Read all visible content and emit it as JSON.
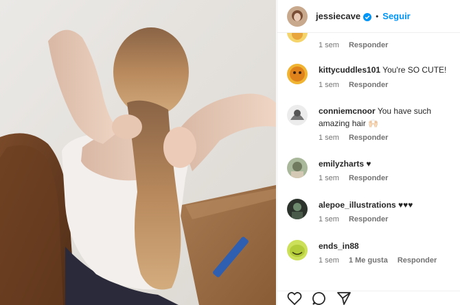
{
  "header": {
    "username": "jessiecave",
    "separator": "•",
    "follow_label": "Seguir",
    "verified_icon": "verified-badge-icon",
    "accent_color": "#0095f6"
  },
  "comments": [
    {
      "username": "",
      "text": "",
      "time": "1 sem",
      "likes": "",
      "reply": "Responder"
    },
    {
      "username": "kittycuddles101",
      "text": "You're SO CUTE!",
      "time": "1 sem",
      "likes": "",
      "reply": "Responder"
    },
    {
      "username": "conniemcnoor",
      "text": "You have such amazing hair 🙌🏻",
      "time": "1 sem",
      "likes": "",
      "reply": "Responder"
    },
    {
      "username": "emilyzharts",
      "text": "♥",
      "time": "1 sem",
      "likes": "",
      "reply": "Responder"
    },
    {
      "username": "alepoe_illustrations",
      "text": "♥♥♥",
      "time": "1 sem",
      "likes": "",
      "reply": "Responder"
    },
    {
      "username": "ends_in88",
      "text": "",
      "time": "1 sem",
      "likes": "1 Me gusta",
      "reply": "Responder"
    }
  ],
  "actions": {
    "like_icon": "heart-icon",
    "comment_icon": "comment-icon",
    "share_icon": "share-icon"
  }
}
